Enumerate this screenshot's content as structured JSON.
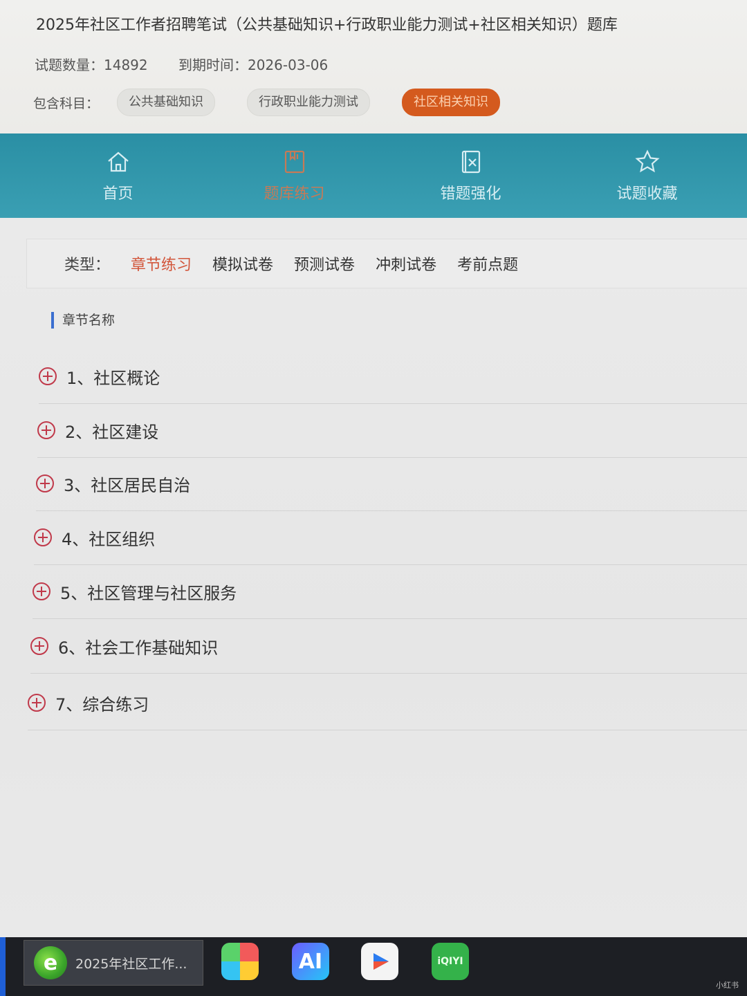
{
  "header": {
    "title": "2025年社区工作者招聘笔试（公共基础知识+行政职业能力测试+社区相关知识）题库",
    "count_label": "试题数量：",
    "count_value": "14892",
    "expire_label": "到期时间：",
    "expire_value": "2026-03-06",
    "subjects_label": "包含科目：",
    "subjects": [
      "公共基础知识",
      "行政职业能力测试",
      "社区相关知识"
    ]
  },
  "nav": {
    "items": [
      {
        "label": "首页",
        "icon": "home-icon"
      },
      {
        "label": "题库练习",
        "icon": "book-icon"
      },
      {
        "label": "错题强化",
        "icon": "wrong-icon"
      },
      {
        "label": "试题收藏",
        "icon": "star-icon"
      }
    ],
    "active_index": 1
  },
  "types": {
    "label": "类型：",
    "items": [
      "章节练习",
      "模拟试卷",
      "预测试卷",
      "冲刺试卷",
      "考前点题"
    ],
    "active_index": 0
  },
  "chapters": {
    "heading": "章节名称",
    "items": [
      "1、社区概论",
      "2、社区建设",
      "3、社区居民自治",
      "4、社区组织",
      "5、社区管理与社区服务",
      "6、社会工作基础知识",
      "7、综合练习"
    ]
  },
  "taskbar": {
    "active_window": "2025年社区工作...",
    "watermark": "小红书"
  },
  "colors": {
    "nav_bg": "#2a8fa4",
    "accent_orange": "#d45a1e",
    "plus_red": "#c0394a"
  }
}
